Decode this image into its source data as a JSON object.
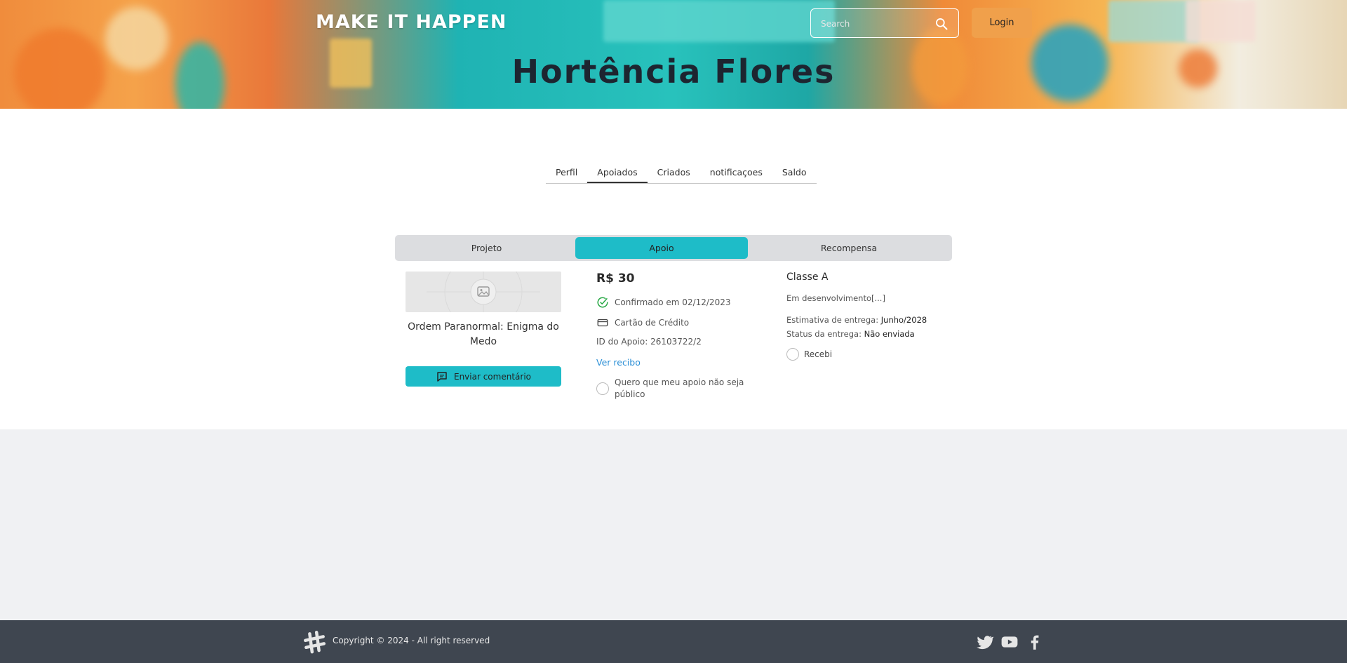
{
  "header": {
    "brand": "MAKE IT HAPPEN",
    "search_placeholder": "Search",
    "login_label": "Login",
    "profile_name": "Hortência Flores"
  },
  "tabs": {
    "items": [
      "Perfil",
      "Apoiados",
      "Criados",
      "notificaçoes",
      "Saldo"
    ],
    "active": "Apoiados"
  },
  "card": {
    "segments": [
      "Projeto",
      "Apoio",
      "Recompensa"
    ],
    "active_segment": "Apoio",
    "project": {
      "title": "Ordem Paranormal: Enigma do Medo",
      "comment_button": "Enviar comentário"
    },
    "support": {
      "amount": "R$ 30",
      "confirmed": "Confirmado em 02/12/2023",
      "payment_method": "Cartão de Crédito",
      "support_id": "ID do Apoio: 26103722/2",
      "receipt_link": "Ver recibo",
      "private_label": "Quero que meu apoio não seja público"
    },
    "reward": {
      "name": "Classe A",
      "description": "Em desenvolvimento[...]",
      "delivery_estimate_label": "Estimativa de entrega:",
      "delivery_estimate_value": "Junho/2028",
      "delivery_status_label": "Status da entrega:",
      "delivery_status_value": "Não enviada",
      "received_label": "Recebi"
    }
  },
  "footer": {
    "copyright": "Copyright © 2024 - All right reserved",
    "social": [
      "twitter-icon",
      "youtube-icon",
      "facebook-icon"
    ]
  },
  "colors": {
    "accent": "#1ebcc8",
    "login": "#f0a04b",
    "footer": "#3f4650",
    "confirmed_green": "#27a844",
    "link": "#2b8fd6"
  }
}
